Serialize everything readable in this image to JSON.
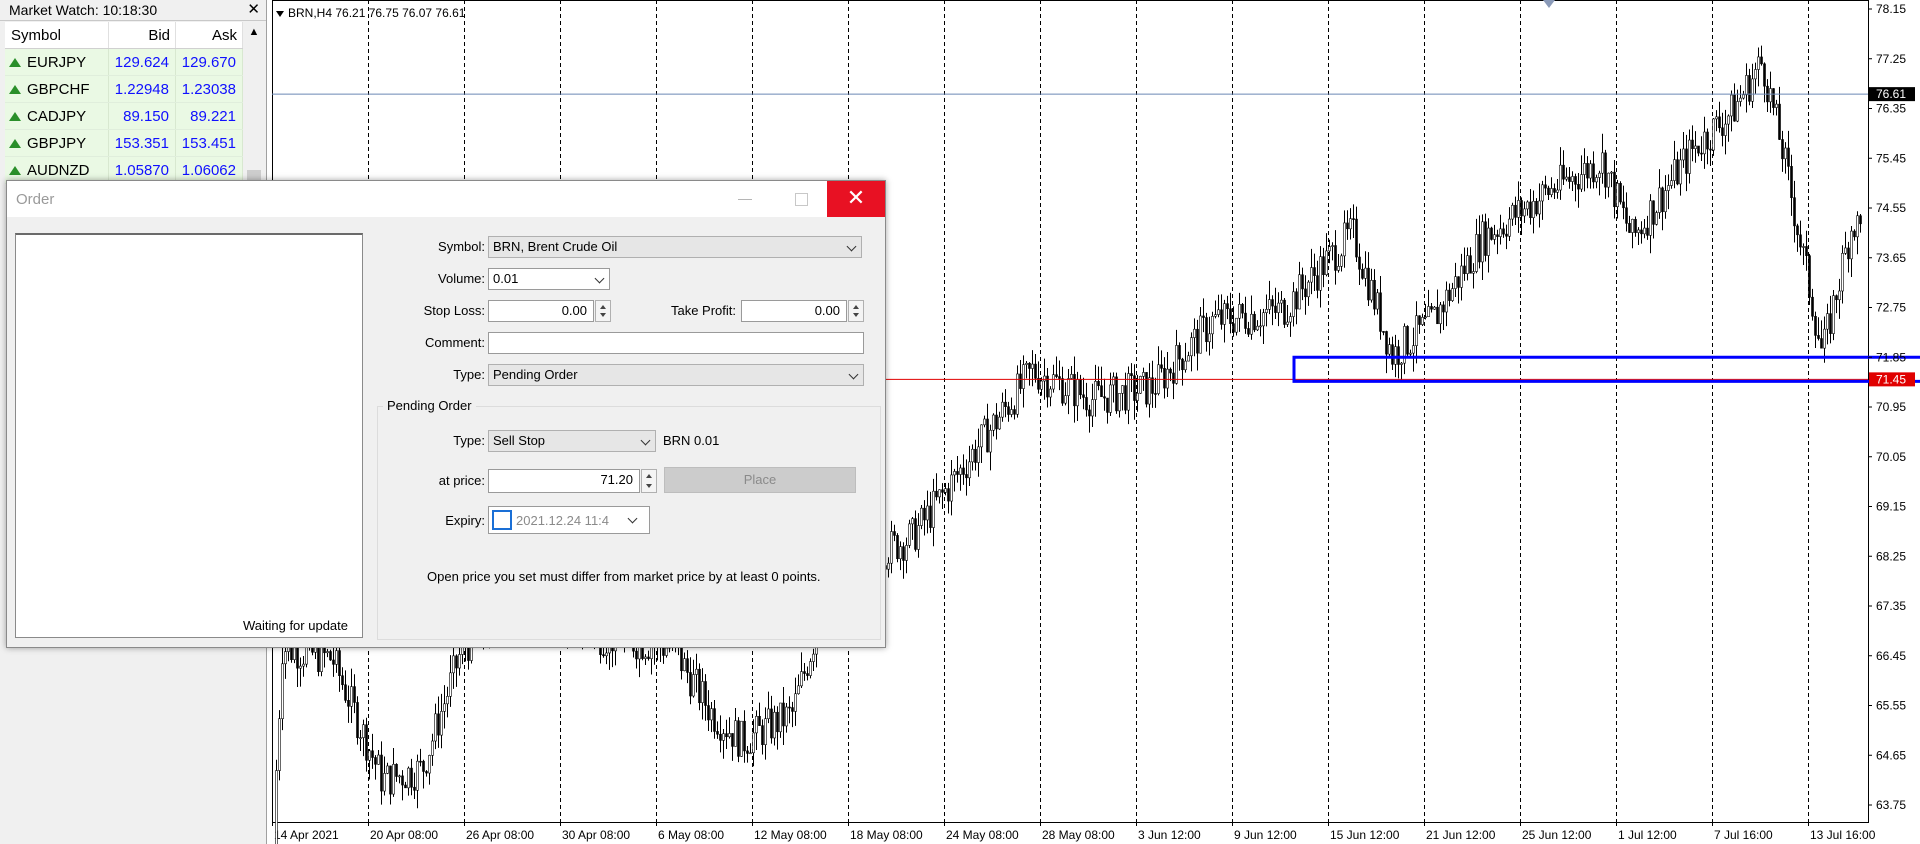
{
  "market_watch": {
    "title": "Market Watch: 10:18:30",
    "columns": [
      "Symbol",
      "Bid",
      "Ask"
    ],
    "rows": [
      {
        "symbol": "EURJPY",
        "bid": "129.624",
        "ask": "129.670"
      },
      {
        "symbol": "GBPCHF",
        "bid": "1.22948",
        "ask": "1.23038"
      },
      {
        "symbol": "CADJPY",
        "bid": "89.150",
        "ask": "89.221"
      },
      {
        "symbol": "GBPJPY",
        "bid": "153.351",
        "ask": "153.451"
      },
      {
        "symbol": "AUDNZD",
        "bid": "1.05870",
        "ask": "1.06062"
      }
    ],
    "close_glyph": "✕"
  },
  "chart": {
    "info": "BRN,H4  76.21 76.75 76.07 76.61",
    "price_scale": [
      "78.15",
      "77.25",
      "76.35",
      "75.45",
      "74.55",
      "73.65",
      "72.75",
      "71.85",
      "70.95",
      "70.05",
      "69.15",
      "68.25",
      "67.35",
      "66.45",
      "65.55",
      "64.65",
      "63.75"
    ],
    "bid_line_label": "76.61",
    "order_line_label": "71.45",
    "time_labels": [
      "14 Apr 2021",
      "20 Apr 08:00",
      "26 Apr 08:00",
      "30 Apr 08:00",
      "6 May 08:00",
      "12 May 08:00",
      "18 May 08:00",
      "24 May 08:00",
      "28 May 08:00",
      "3 Jun 12:00",
      "9 Jun 12:00",
      "15 Jun 12:00",
      "21 Jun 12:00",
      "25 Jun 12:00",
      "1 Jul 12:00",
      "7 Jul 16:00",
      "13 Jul 16:00"
    ],
    "colors": {
      "bid_line": "#6a86b4",
      "order_line": "#e00000",
      "highlight_box": "#0000ff",
      "candles": "#000000"
    }
  },
  "order_dialog": {
    "title": "Order",
    "min_glyph": "—",
    "close_glyph": "✕",
    "tick_status": "Waiting for update",
    "labels": {
      "symbol": "Symbol:",
      "volume": "Volume:",
      "stop_loss": "Stop Loss:",
      "take_profit": "Take Profit:",
      "comment": "Comment:",
      "type": "Type:",
      "pending_group": "Pending Order",
      "pending_type": "Type:",
      "at_price": "at price:",
      "expiry": "Expiry:"
    },
    "values": {
      "symbol": "BRN, Brent Crude Oil",
      "volume": "0.01",
      "stop_loss": "0.00",
      "take_profit": "0.00",
      "comment": "",
      "type": "Pending Order",
      "pending_type": "Sell Stop",
      "pending_info": "BRN 0.01",
      "at_price": "71.20",
      "expiry": "2021.12.24 11:4"
    },
    "place_button": "Place",
    "notice": "Open price you set must differ from market price by at least 0 points."
  }
}
